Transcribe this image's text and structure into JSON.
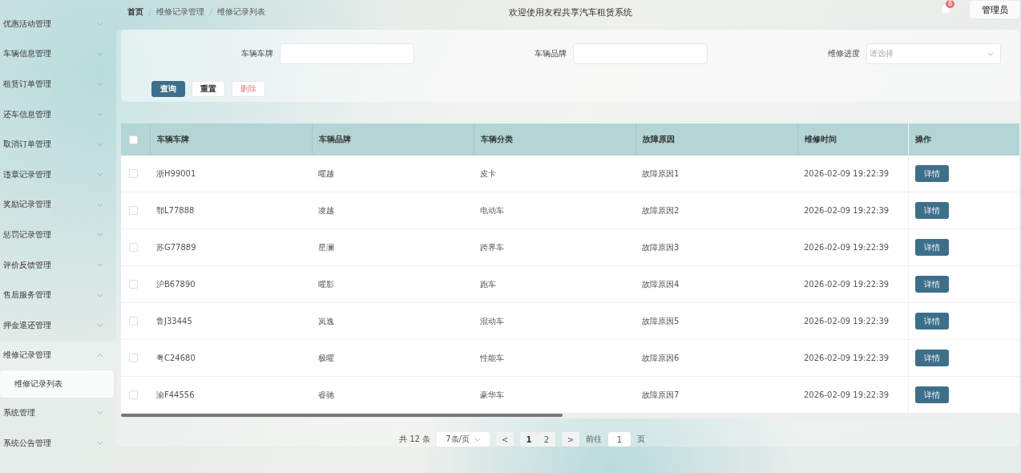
{
  "sidebar": {
    "items": [
      {
        "label": "优惠活动管理",
        "expanded": false
      },
      {
        "label": "车辆信息管理",
        "expanded": false
      },
      {
        "label": "租赁订单管理",
        "expanded": false
      },
      {
        "label": "还车信息管理",
        "expanded": false
      },
      {
        "label": "取消订单管理",
        "expanded": false
      },
      {
        "label": "违章记录管理",
        "expanded": false
      },
      {
        "label": "奖励记录管理",
        "expanded": false
      },
      {
        "label": "惩罚记录管理",
        "expanded": false
      },
      {
        "label": "评价反馈管理",
        "expanded": false
      },
      {
        "label": "售后服务管理",
        "expanded": false
      },
      {
        "label": "押金退还管理",
        "expanded": false
      },
      {
        "label": "维修记录管理",
        "expanded": true,
        "children": [
          {
            "label": "维修记录列表",
            "selected": true
          }
        ]
      },
      {
        "label": "系统管理",
        "expanded": false
      },
      {
        "label": "系统公告管理",
        "expanded": false
      }
    ]
  },
  "breadcrumb": [
    "首页",
    "维修记录管理",
    "维修记录列表"
  ],
  "header": {
    "title": "欢迎使用友程共享汽车租赁系统",
    "notification_badge": "8",
    "user": "管理员"
  },
  "search": {
    "fields": [
      {
        "kind": "text",
        "label": "车辆车牌"
      },
      {
        "kind": "text",
        "label": "车辆品牌"
      },
      {
        "kind": "select",
        "label": "维修进度",
        "placeholder": "请选择"
      }
    ],
    "buttons": [
      {
        "kind": "primary",
        "label": "查询"
      },
      {
        "kind": "plain",
        "label": "重置"
      },
      {
        "kind": "danger",
        "label": "删除"
      }
    ]
  },
  "table": {
    "select_all_checked": false,
    "columns": [
      "车辆车牌",
      "车辆品牌",
      "车辆分类",
      "故障原因",
      "维修时间",
      "操作"
    ],
    "rows": [
      {
        "checked": false,
        "cells": [
          "浙H99001",
          "曜越",
          "皮卡",
          "故障原因1",
          "2026-02-09 19:22:39"
        ],
        "action": "详情"
      },
      {
        "checked": false,
        "cells": [
          "鄂L77888",
          "凌越",
          "电动车",
          "故障原因2",
          "2026-02-09 19:22:39"
        ],
        "action": "详情"
      },
      {
        "checked": false,
        "cells": [
          "苏G77889",
          "星澜",
          "跨界车",
          "故障原因3",
          "2026-02-09 19:22:39"
        ],
        "action": "详情"
      },
      {
        "checked": false,
        "cells": [
          "沪B67890",
          "曜影",
          "跑车",
          "故障原因4",
          "2026-02-09 19:22:39"
        ],
        "action": "详情"
      },
      {
        "checked": false,
        "cells": [
          "鲁J33445",
          "岚逸",
          "混动车",
          "故障原因5",
          "2026-02-09 19:22:39"
        ],
        "action": "详情"
      },
      {
        "checked": false,
        "cells": [
          "粤C24680",
          "极曜",
          "性能车",
          "故障原因6",
          "2026-02-09 19:22:39"
        ],
        "action": "详情"
      },
      {
        "checked": false,
        "cells": [
          "渝F44556",
          "睿驰",
          "豪华车",
          "故障原因7",
          "2026-02-09 19:22:39"
        ],
        "action": "详情"
      }
    ]
  },
  "pagination": {
    "total": "共 12 条",
    "page_size": "7条/页",
    "prev": "<",
    "next": ">",
    "pages": [
      {
        "label": "1",
        "selected": true
      },
      {
        "label": "2",
        "selected": false
      }
    ],
    "goto_label": "前往",
    "goto_value": "1",
    "goto_suffix": "页"
  }
}
